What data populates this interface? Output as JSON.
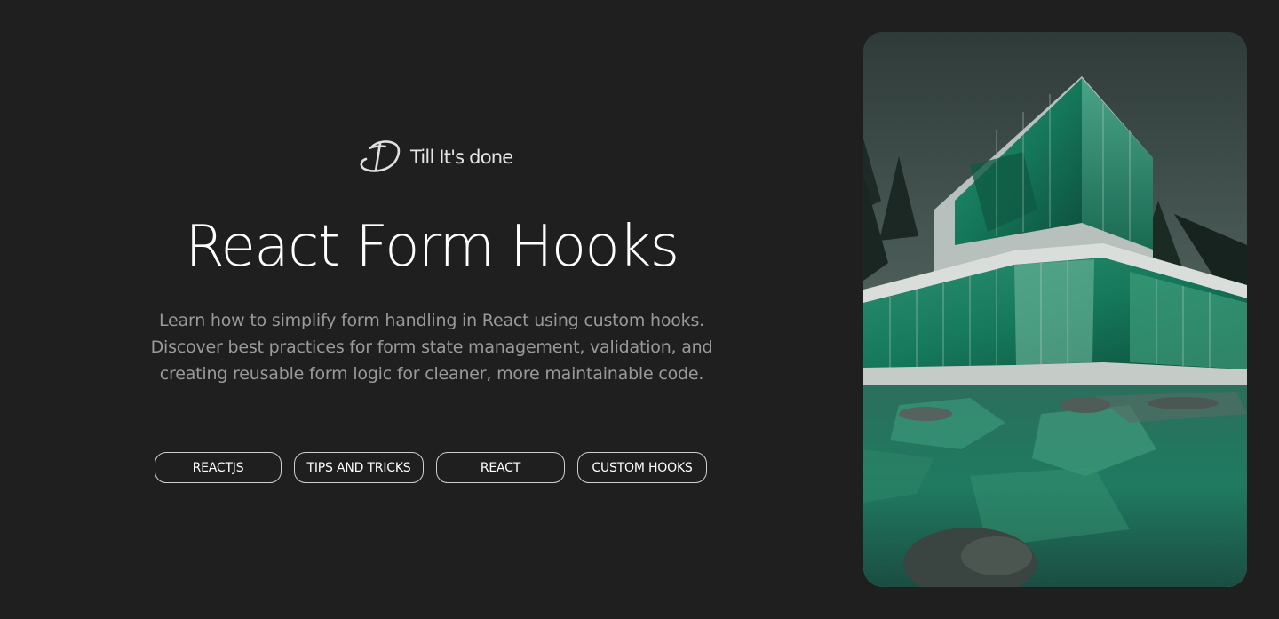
{
  "brand": {
    "logo_icon": "td-monogram-logo-icon",
    "name": "Till It's done"
  },
  "post": {
    "title": "React Form Hooks",
    "description_lines": [
      "Learn how to simplify form handling in React using custom hooks.",
      "Discover best practices for form state management, validation, and",
      "creating reusable form logic for cleaner, more maintainable code."
    ],
    "tags": [
      "REACTJS",
      "TIPS AND TRICKS",
      "REACT",
      "CUSTOM HOOKS"
    ]
  },
  "hero_image": {
    "subject": "modern glass building reflected in water",
    "accent_color": "#1f8a66"
  },
  "colors": {
    "background": "#1f1f1f",
    "title": "#ffffff",
    "description": "#9a9a9a",
    "tag_border": "#cfcfcf"
  }
}
